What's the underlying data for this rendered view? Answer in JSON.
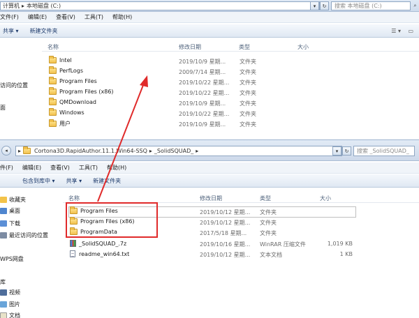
{
  "top_window": {
    "address": {
      "crumbs": [
        "计算机",
        "本地磁盘 (C:)"
      ]
    },
    "search_placeholder": "搜索 本地磁盘 (C:)",
    "menu": [
      "文件(F)",
      "编辑(E)",
      "查看(V)",
      "工具(T)",
      "帮助(H)"
    ],
    "toolbar": {
      "share": "共享 ▾",
      "new_folder": "新建文件夹"
    },
    "nav_items": [
      "访问的位置",
      "面"
    ],
    "columns": {
      "name": "名称",
      "date": "修改日期",
      "type": "类型",
      "size": "大小"
    },
    "rows": [
      {
        "name": "Intel",
        "date": "2019/10/9 星期...",
        "type": "文件夹"
      },
      {
        "name": "PerfLogs",
        "date": "2009/7/14 星期...",
        "type": "文件夹"
      },
      {
        "name": "Program Files",
        "date": "2019/10/22 星期...",
        "type": "文件夹"
      },
      {
        "name": "Program Files (x86)",
        "date": "2019/10/22 星期...",
        "type": "文件夹"
      },
      {
        "name": "QMDownload",
        "date": "2019/10/9 星期...",
        "type": "文件夹"
      },
      {
        "name": "Windows",
        "date": "2019/10/22 星期...",
        "type": "文件夹"
      },
      {
        "name": "用户",
        "date": "2019/10/9 星期...",
        "type": "文件夹"
      }
    ]
  },
  "bottom_window": {
    "address": {
      "crumbs": [
        "Cortona3D.RapidAuthor.11.1.Win64-SSQ",
        "_SolidSQUAD_"
      ]
    },
    "search_placeholder": "搜索 _SolidSQUAD_",
    "menu": [
      "件(F)",
      "编辑(E)",
      "查看(V)",
      "工具(T)",
      "帮助(H)"
    ],
    "toolbar": {
      "include": "包含到库中 ▾",
      "share": "共享 ▾",
      "new_folder": "新建文件夹"
    },
    "nav_items": [
      "收藏夹",
      "桌面",
      "下载",
      "最近访问的位置",
      "WPS网盘",
      "库",
      "视频",
      "图片",
      "文档"
    ],
    "columns": {
      "name": "名称",
      "date": "修改日期",
      "type": "类型",
      "size": "大小"
    },
    "rows": [
      {
        "name": "Program Files",
        "date": "2019/10/12 星期...",
        "type": "文件夹",
        "size": "",
        "icon": "folder-icon"
      },
      {
        "name": "Program Files (x86)",
        "date": "2019/10/12 星期...",
        "type": "文件夹",
        "size": "",
        "icon": "folder-icon"
      },
      {
        "name": "ProgramData",
        "date": "2017/5/18 星期...",
        "type": "文件夹",
        "size": "",
        "icon": "folder-icon"
      },
      {
        "name": "_SolidSQUAD_.7z",
        "date": "2019/10/16 星期...",
        "type": "WinRAR 压缩文件",
        "size": "1,019 KB",
        "icon": "archive-icon"
      },
      {
        "name": "readme_win64.txt",
        "date": "2019/10/12 星期...",
        "type": "文本文档",
        "size": "1 KB",
        "icon": "text-file-icon"
      }
    ]
  },
  "colors": {
    "highlight": "#e02a2a",
    "toolbar_text": "#1e3b6c"
  }
}
